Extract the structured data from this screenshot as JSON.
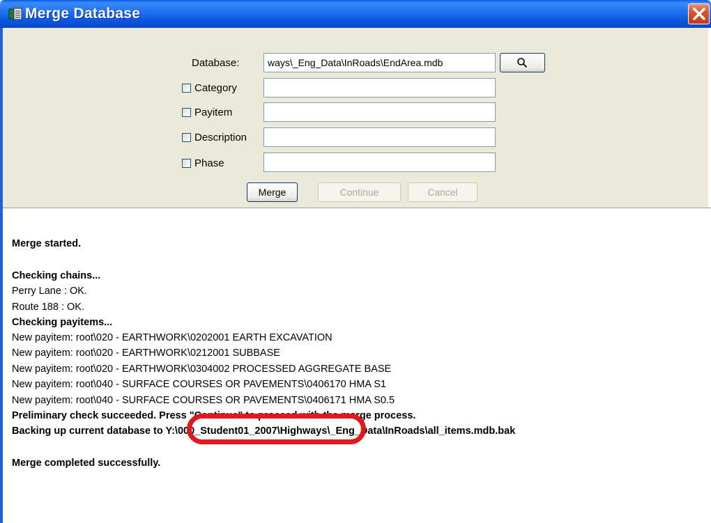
{
  "window": {
    "title": "Merge Database",
    "icon": "database-icon",
    "close_icon": "close-icon"
  },
  "form": {
    "database_label": "Database:",
    "database_value": "ways\\_Eng_Data\\InRoads\\EndArea.mdb",
    "browse_icon": "search-icon",
    "fields": [
      {
        "label": "Category",
        "checked": false,
        "value": ""
      },
      {
        "label": "Payitem",
        "checked": false,
        "value": ""
      },
      {
        "label": "Description",
        "checked": false,
        "value": ""
      },
      {
        "label": "Phase",
        "checked": false,
        "value": ""
      }
    ],
    "buttons": {
      "merge": "Merge",
      "continue": "Continue",
      "cancel": "Cancel"
    }
  },
  "log": {
    "lines": [
      {
        "text": "Merge started.",
        "bold": true
      },
      {
        "text": "Checking chains...",
        "bold": true
      },
      {
        "text": "Perry Lane : OK.",
        "bold": false
      },
      {
        "text": "Route 188 : OK.",
        "bold": false
      },
      {
        "text": "Checking payitems...",
        "bold": true
      },
      {
        "text": "New payitem: root\\020 - EARTHWORK\\0202001 EARTH EXCAVATION",
        "bold": false
      },
      {
        "text": "New payitem: root\\020 - EARTHWORK\\0212001 SUBBASE",
        "bold": false
      },
      {
        "text": "New payitem: root\\020 - EARTHWORK\\0304002 PROCESSED AGGREGATE BASE",
        "bold": false
      },
      {
        "text": "New payitem: root\\040 - SURFACE COURSES OR PAVEMENTS\\0406170 HMA S1",
        "bold": false
      },
      {
        "text": "New payitem: root\\040 - SURFACE COURSES OR PAVEMENTS\\0406171 HMA S0.5",
        "bold": false
      },
      {
        "text": "Preliminary check succeeded. Press \"Continue\" to proceed with the merge process.",
        "bold": true
      },
      {
        "text": "Backing up current database to Y:\\000_Student01_2007\\Highways\\_Eng_Data\\InRoads\\all_items.mdb.bak",
        "bold": true
      },
      {
        "text": "Merge completed successfully.",
        "bold": true
      }
    ]
  },
  "colors": {
    "titlebar": "#0a56e0",
    "panel": "#ece9d8",
    "annotation": "#e0181f"
  }
}
